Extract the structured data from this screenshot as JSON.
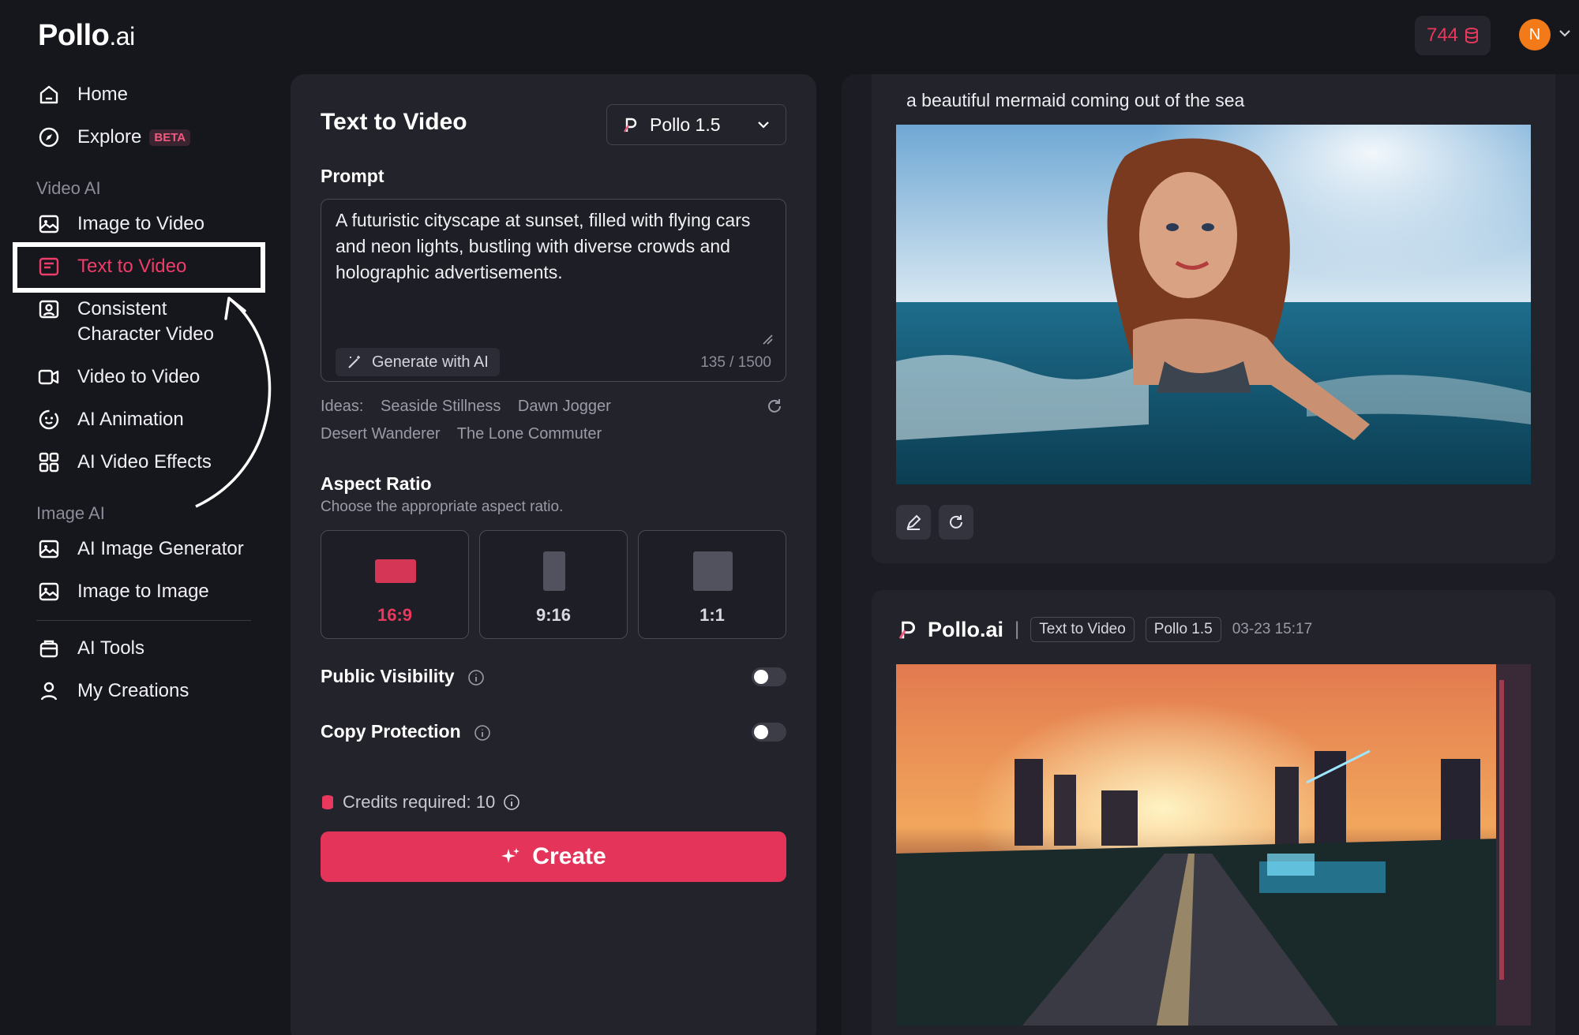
{
  "brand": {
    "name": "Pollo",
    "suffix": ".ai"
  },
  "header": {
    "credits": "744"
  },
  "user": {
    "initial": "N"
  },
  "sidebar": {
    "home": "Home",
    "explore": "Explore",
    "beta": "BETA",
    "video_section": "Video AI",
    "video_items": [
      "Image to Video",
      "Text to Video",
      "Consistent",
      "Character Video",
      "Video to Video",
      "AI Animation",
      "AI Video Effects"
    ],
    "image_section": "Image AI",
    "image_items": [
      "AI Image Generator",
      "Image to Image"
    ],
    "tools": "AI Tools",
    "creations": "My Creations",
    "active_item": "Text to Video"
  },
  "panel": {
    "title": "Text to Video",
    "model": "Pollo 1.5",
    "prompt_label": "Prompt",
    "prompt_text": "A futuristic cityscape at sunset, filled with flying cars and neon lights, bustling with diverse crowds and holographic advertisements.",
    "generate_label": "Generate with AI",
    "char_count": "135 / 1500",
    "ideas_label": "Ideas:",
    "ideas": [
      "Seaside Stillness",
      "Dawn Jogger",
      "Desert Wanderer",
      "The Lone Commuter"
    ],
    "aspect_title": "Aspect Ratio",
    "aspect_subtitle": "Choose the appropriate aspect ratio.",
    "aspect_options": [
      "16:9",
      "9:16",
      "1:1"
    ],
    "aspect_selected": "16:9",
    "public_visibility": "Public Visibility",
    "public_visibility_on": false,
    "copy_protection": "Copy Protection",
    "copy_protection_on": false,
    "credits_required": "Credits required: 10",
    "create_label": "Create"
  },
  "results": {
    "first": {
      "caption": "a beautiful mermaid coming out of the sea"
    },
    "second": {
      "brand": "Pollo.ai",
      "sep": "|",
      "mode": "Text to Video",
      "model": "Pollo 1.5",
      "date": "03-23 15:17"
    }
  },
  "colors": {
    "accent": "#e4345a",
    "background": "#16161d",
    "panel": "#23232c"
  }
}
